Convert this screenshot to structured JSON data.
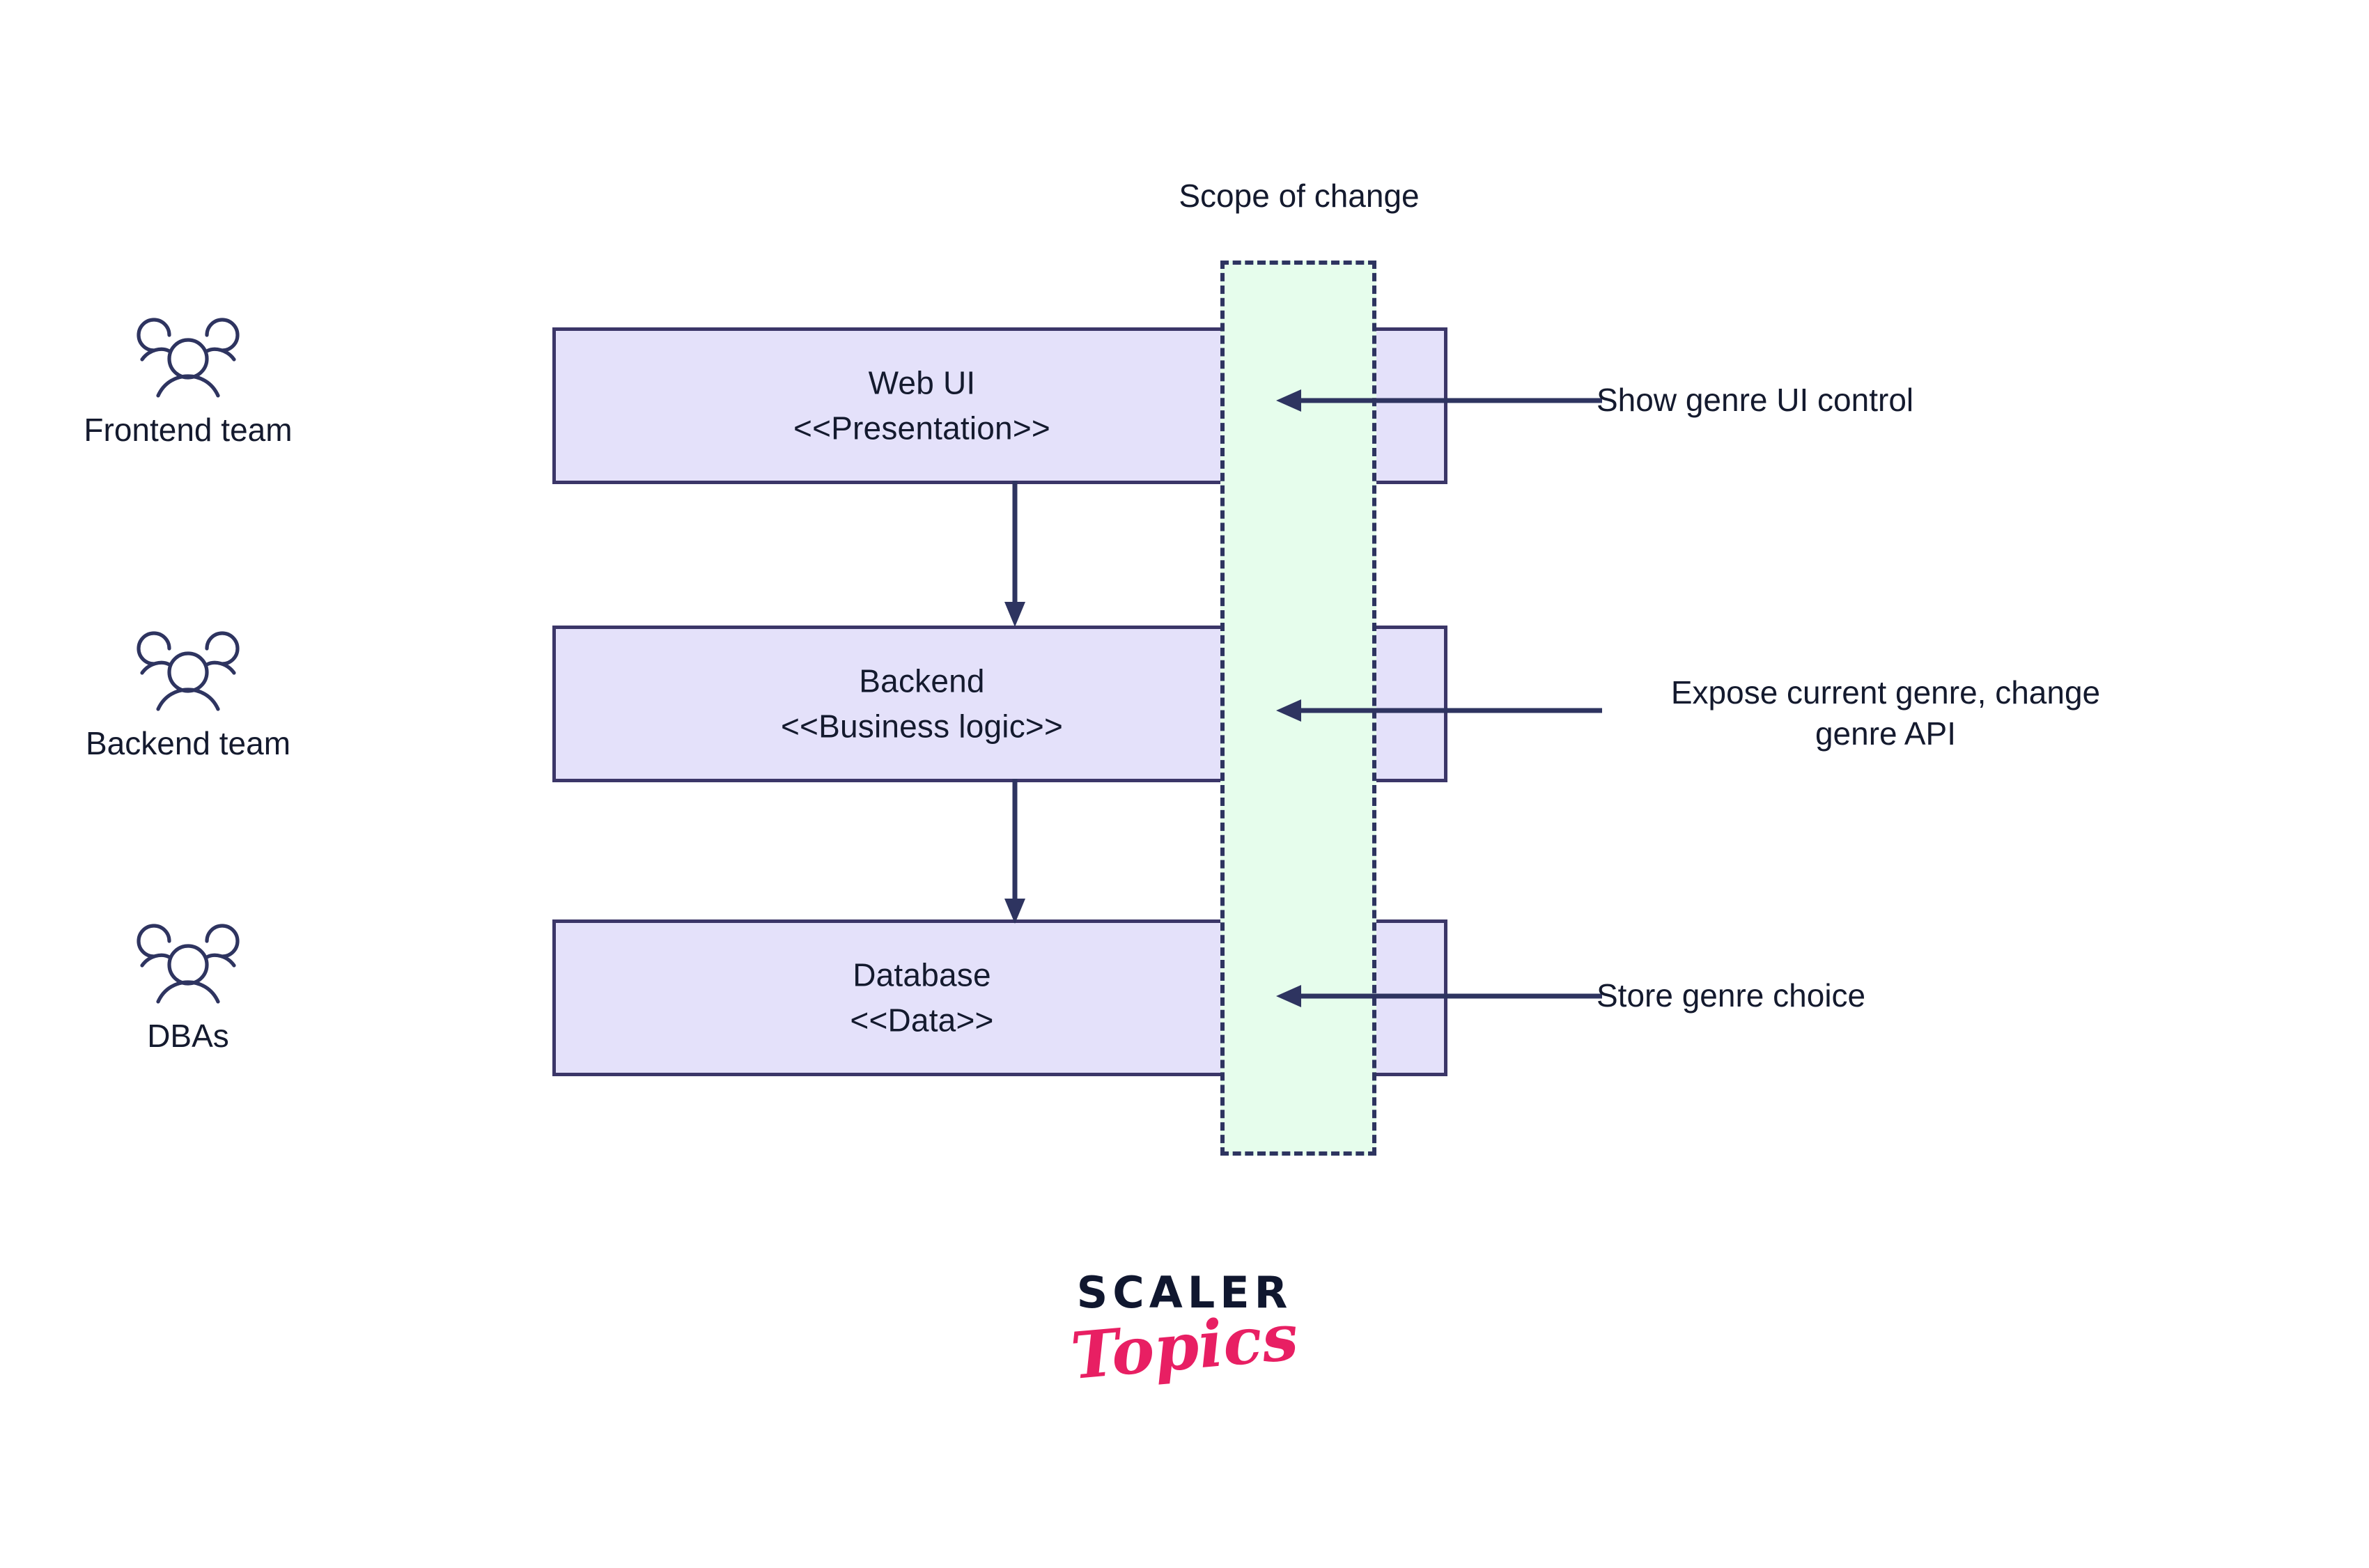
{
  "diagram": {
    "title": "Scope of change",
    "scope_band": {
      "label": "Scope of change",
      "fill_color": "#e6fdec",
      "border_color": "#2e3460",
      "border_style": "dashed"
    },
    "colors": {
      "box_fill": "#e4e1fa",
      "box_border": "#3b3668",
      "text": "#141a2e",
      "icon": "#2e3460",
      "arrow": "#2e3460",
      "brand_dark": "#10172f",
      "brand_pink": "#e81f63",
      "background": "#ffffff"
    },
    "layers": [
      {
        "id": "web-ui",
        "name": "Web UI",
        "stereotype": "<<Presentation>>",
        "team": {
          "label": "Frontend team",
          "icon": "people-group-icon"
        },
        "annotation": {
          "line1": "Show genre UI control",
          "line2": ""
        }
      },
      {
        "id": "backend",
        "name": "Backend",
        "stereotype": "<<Business logic>>",
        "team": {
          "label": "Backend team",
          "icon": "people-group-icon"
        },
        "annotation": {
          "line1": "Expose current genre, change",
          "line2": "genre API"
        }
      },
      {
        "id": "database",
        "name": "Database",
        "stereotype": "<<Data>>",
        "team": {
          "label": "DBAs",
          "icon": "people-group-icon"
        },
        "annotation": {
          "line1": "Store genre choice",
          "line2": ""
        }
      }
    ],
    "connectors": [
      {
        "from": "web-ui",
        "to": "backend",
        "direction": "down"
      },
      {
        "from": "backend",
        "to": "database",
        "direction": "down"
      }
    ]
  },
  "brand": {
    "primary": "SCALER",
    "secondary": "Topics"
  }
}
